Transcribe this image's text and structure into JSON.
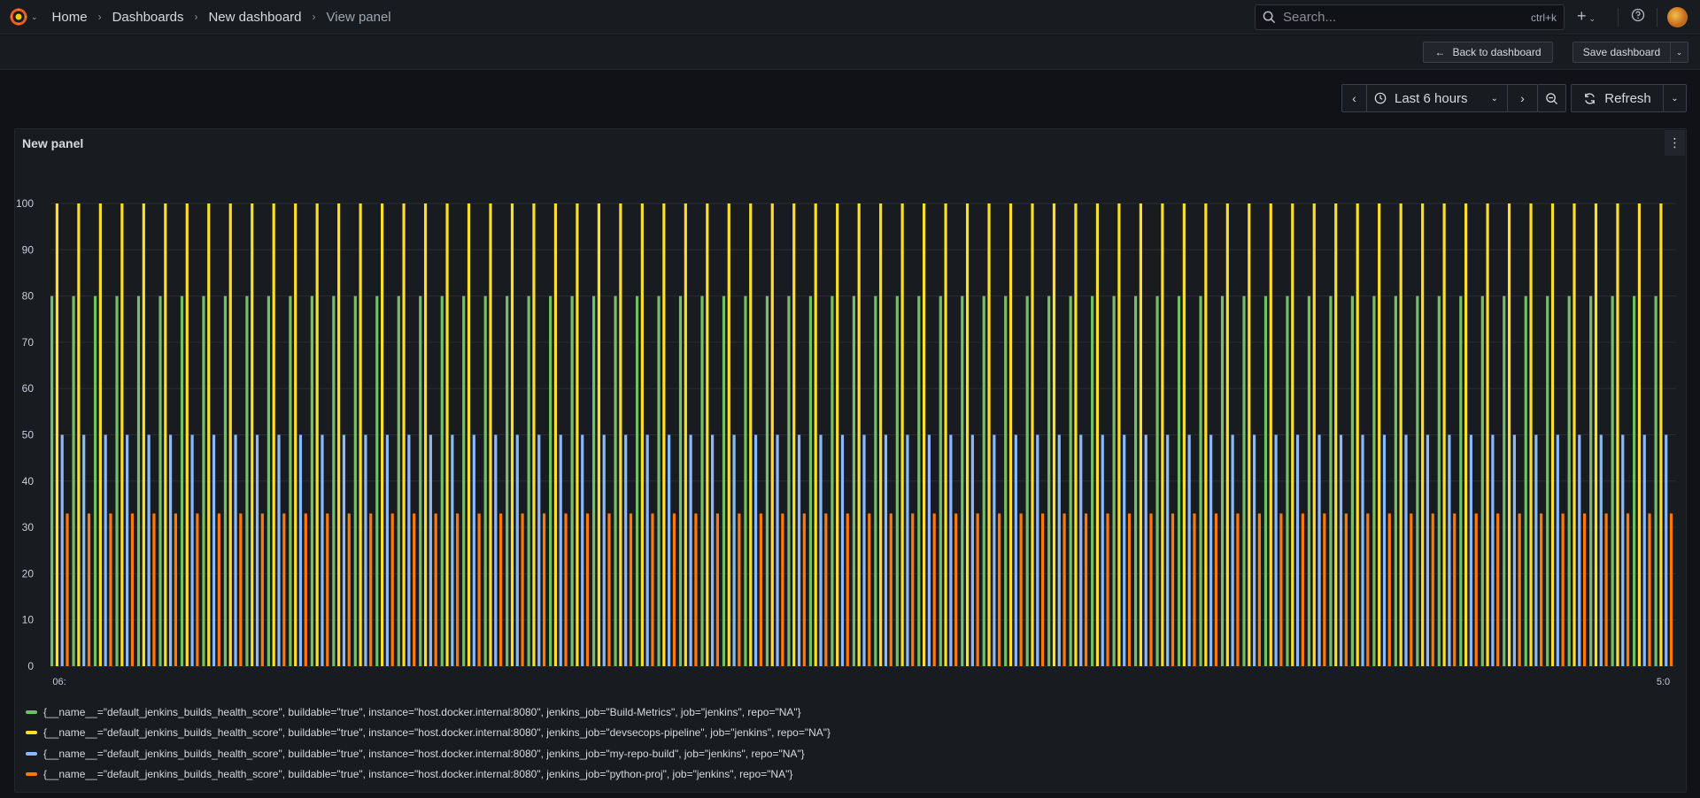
{
  "nav": {
    "breadcrumbs": [
      "Home",
      "Dashboards",
      "New dashboard",
      "View panel"
    ],
    "search_placeholder": "Search...",
    "search_shortcut": "ctrl+k"
  },
  "toolbar": {
    "back_label": "Back to dashboard",
    "save_label": "Save dashboard",
    "time_range": "Last 6 hours",
    "refresh_label": "Refresh"
  },
  "panel": {
    "title": "New panel"
  },
  "colors": {
    "green": "#73bf69",
    "yellow": "#fade2a",
    "blue": "#8ab8ff",
    "orange": "#ff780a"
  },
  "chart_data": {
    "type": "bar",
    "ylim": [
      0,
      100
    ],
    "y_ticks": [
      0,
      10,
      20,
      30,
      40,
      50,
      60,
      70,
      80,
      90,
      100
    ],
    "x_first_label": "06:",
    "x_last_label": "5:0",
    "group_count": 75,
    "grid": true,
    "legend_position": "bottom",
    "series": [
      {
        "name": "{__name__=\"default_jenkins_builds_health_score\", buildable=\"true\", instance=\"host.docker.internal:8080\", jenkins_job=\"Build-Metrics\", job=\"jenkins\", repo=\"NA\"}",
        "color": "#73bf69",
        "value": 80
      },
      {
        "name": "{__name__=\"default_jenkins_builds_health_score\", buildable=\"true\", instance=\"host.docker.internal:8080\", jenkins_job=\"devsecops-pipeline\", job=\"jenkins\", repo=\"NA\"}",
        "color": "#fade2a",
        "value": 100
      },
      {
        "name": "{__name__=\"default_jenkins_builds_health_score\", buildable=\"true\", instance=\"host.docker.internal:8080\", jenkins_job=\"my-repo-build\", job=\"jenkins\", repo=\"NA\"}",
        "color": "#8ab8ff",
        "value": 50
      },
      {
        "name": "{__name__=\"default_jenkins_builds_health_score\", buildable=\"true\", instance=\"host.docker.internal:8080\", jenkins_job=\"python-proj\", job=\"jenkins\", repo=\"NA\"}",
        "color": "#ff780a",
        "value": 33
      }
    ]
  }
}
